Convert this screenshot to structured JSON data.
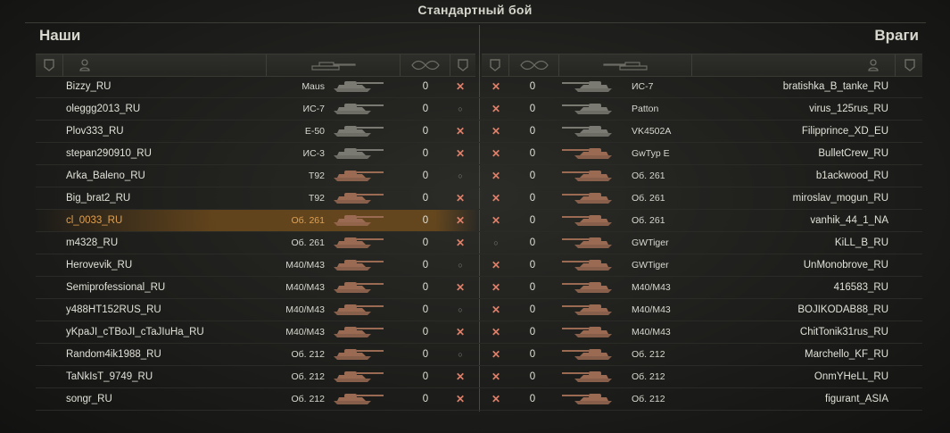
{
  "title": "Стандартный бой",
  "teams": {
    "allies_label": "Наши",
    "enemies_label": "Враги"
  },
  "icons": {
    "status_column": "shield-icon",
    "player_column": "player-icon",
    "tank_column": "tank-icon",
    "frags_column": "frags-icon",
    "dead": "destroyed-x-icon",
    "alive": "alive-dot-icon"
  },
  "colors": {
    "highlight": "#96601a",
    "dead_marker": "#e0806a",
    "self_text": "#e0a050",
    "light_tank": "#7a7a72",
    "heavy_tank": "#9a6a52"
  },
  "symbols": {
    "dead": "✕",
    "alive": "○"
  },
  "rows": [
    {
      "ally_name": "Bizzy_RU",
      "ally_tank": "Maus",
      "ally_frags": "0",
      "ally_dead": true,
      "enemy_dead": true,
      "enemy_frags": "0",
      "enemy_tank": "ИС-7",
      "enemy_name": "bratishka_B_tanke_RU",
      "ally_tint": "gray",
      "enemy_tint": "gray"
    },
    {
      "ally_name": "oleggg2013_RU",
      "ally_tank": "ИС-7",
      "ally_frags": "0",
      "ally_dead": false,
      "enemy_dead": true,
      "enemy_frags": "0",
      "enemy_tank": "Patton",
      "enemy_name": "virus_125rus_RU",
      "ally_tint": "gray",
      "enemy_tint": "gray"
    },
    {
      "ally_name": "Plov333_RU",
      "ally_tank": "E-50",
      "ally_frags": "0",
      "ally_dead": true,
      "enemy_dead": true,
      "enemy_frags": "0",
      "enemy_tank": "VK4502A",
      "enemy_name": "Filipprince_XD_EU",
      "ally_tint": "gray",
      "enemy_tint": "gray"
    },
    {
      "ally_name": "stepan290910_RU",
      "ally_tank": "ИС-3",
      "ally_frags": "0",
      "ally_dead": true,
      "enemy_dead": true,
      "enemy_frags": "0",
      "enemy_tank": "GwTyp E",
      "enemy_name": "BulletCrew_RU",
      "ally_tint": "gray",
      "enemy_tint": "brown"
    },
    {
      "ally_name": "Arka_Baleno_RU",
      "ally_tank": "T92",
      "ally_frags": "0",
      "ally_dead": false,
      "enemy_dead": true,
      "enemy_frags": "0",
      "enemy_tank": "Об. 261",
      "enemy_name": "b1ackwood_RU",
      "ally_tint": "brown",
      "enemy_tint": "brown"
    },
    {
      "ally_name": "Big_brat2_RU",
      "ally_tank": "T92",
      "ally_frags": "0",
      "ally_dead": true,
      "enemy_dead": true,
      "enemy_frags": "0",
      "enemy_tank": "Об. 261",
      "enemy_name": "miroslav_mogun_RU",
      "ally_tint": "brown",
      "enemy_tint": "brown"
    },
    {
      "ally_name": "cl_0033_RU",
      "ally_tank": "Об. 261",
      "ally_frags": "0",
      "ally_dead": true,
      "enemy_dead": true,
      "enemy_frags": "0",
      "enemy_tank": "Об. 261",
      "enemy_name": "vanhik_44_1_NA",
      "ally_tint": "brown",
      "enemy_tint": "brown",
      "self": true
    },
    {
      "ally_name": "m4328_RU",
      "ally_tank": "Об. 261",
      "ally_frags": "0",
      "ally_dead": true,
      "enemy_dead": false,
      "enemy_frags": "0",
      "enemy_tank": "GWTiger",
      "enemy_name": "KiLL_B_RU",
      "ally_tint": "brown",
      "enemy_tint": "brown"
    },
    {
      "ally_name": "Herovevik_RU",
      "ally_tank": "M40/M43",
      "ally_frags": "0",
      "ally_dead": false,
      "enemy_dead": true,
      "enemy_frags": "0",
      "enemy_tank": "GWTiger",
      "enemy_name": "UnMonobrove_RU",
      "ally_tint": "brown",
      "enemy_tint": "brown"
    },
    {
      "ally_name": "Semiprofessional_RU",
      "ally_tank": "M40/M43",
      "ally_frags": "0",
      "ally_dead": true,
      "enemy_dead": true,
      "enemy_frags": "0",
      "enemy_tank": "M40/M43",
      "enemy_name": "416583_RU",
      "ally_tint": "brown",
      "enemy_tint": "brown"
    },
    {
      "ally_name": "y488HT152RUS_RU",
      "ally_tank": "M40/M43",
      "ally_frags": "0",
      "ally_dead": false,
      "enemy_dead": true,
      "enemy_frags": "0",
      "enemy_tank": "M40/M43",
      "enemy_name": "BOJIKODAB88_RU",
      "ally_tint": "brown",
      "enemy_tint": "brown"
    },
    {
      "ally_name": "yKpaJI_cTBoJI_cTaJIuHa_RU",
      "ally_tank": "M40/M43",
      "ally_frags": "0",
      "ally_dead": true,
      "enemy_dead": true,
      "enemy_frags": "0",
      "enemy_tank": "M40/M43",
      "enemy_name": "ChitTonik31rus_RU",
      "ally_tint": "brown",
      "enemy_tint": "brown"
    },
    {
      "ally_name": "Random4ik1988_RU",
      "ally_tank": "Об. 212",
      "ally_frags": "0",
      "ally_dead": false,
      "enemy_dead": true,
      "enemy_frags": "0",
      "enemy_tank": "Об. 212",
      "enemy_name": "Marchello_KF_RU",
      "ally_tint": "brown",
      "enemy_tint": "brown"
    },
    {
      "ally_name": "TaNkIsT_9749_RU",
      "ally_tank": "Об. 212",
      "ally_frags": "0",
      "ally_dead": true,
      "enemy_dead": true,
      "enemy_frags": "0",
      "enemy_tank": "Об. 212",
      "enemy_name": "OnmYHeLL_RU",
      "ally_tint": "brown",
      "enemy_tint": "brown"
    },
    {
      "ally_name": "songr_RU",
      "ally_tank": "Об. 212",
      "ally_frags": "0",
      "ally_dead": true,
      "enemy_dead": true,
      "enemy_frags": "0",
      "enemy_tank": "Об. 212",
      "enemy_name": "figurant_ASIA",
      "ally_tint": "brown",
      "enemy_tint": "brown"
    }
  ]
}
